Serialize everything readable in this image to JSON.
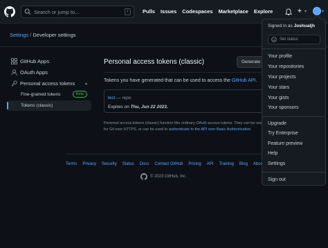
{
  "header": {
    "search_placeholder": "Search or jump to...",
    "search_shortcut": "/",
    "nav": [
      "Pulls",
      "Issues",
      "Codespaces",
      "Marketplace",
      "Explore"
    ],
    "plus_label": "+"
  },
  "breadcrumb": {
    "settings": "Settings",
    "separator": "/",
    "current": "Developer settings"
  },
  "sidebar": {
    "items": [
      {
        "label": "GitHub Apps",
        "icon": "apps-icon"
      },
      {
        "label": "OAuth Apps",
        "icon": "person-icon"
      },
      {
        "label": "Personal access tokens",
        "icon": "key-icon"
      }
    ],
    "sub_items": [
      {
        "label": "Fine-grained tokens",
        "badge": "Beta"
      },
      {
        "label": "Tokens (classic)"
      }
    ]
  },
  "main": {
    "title": "Personal access tokens (classic)",
    "generate_button": "Generate new token",
    "description_prefix": "Tokens you have generated that can be used to access the ",
    "description_link": "GitHub API",
    "description_suffix": ".",
    "token": {
      "name": "test",
      "scope": "— repo",
      "expires_label": "Expires on ",
      "expires_date": "Thu, Jun 22 2023."
    },
    "note_line1": "Personal access tokens (classic) function like ordinary OAuth access tokens. They can be used instead of a password",
    "note_line2_prefix": "for Git over HTTPS, or can be used to ",
    "note_line2_link": "authenticate to the API over Basic Authentication"
  },
  "footer": {
    "links": [
      "Terms",
      "Privacy",
      "Security",
      "Status",
      "Docs",
      "Contact GitHub",
      "Pricing",
      "API",
      "Training",
      "Blog",
      "About"
    ],
    "copyright": "© 2023 GitHub, Inc."
  },
  "dropdown": {
    "signed_in_prefix": "Signed in as ",
    "username": "Joshualjh",
    "status_placeholder": "Set status",
    "group1": [
      "Your profile",
      "Your repositories",
      "Your projects",
      "Your stars",
      "Your gists",
      "Your sponsors"
    ],
    "group2": [
      "Upgrade",
      "Try Enterprise",
      "Feature preview",
      "Help",
      "Settings"
    ],
    "sign_out": "Sign out"
  },
  "colors": {
    "background": "#0d1117",
    "header": "#161b22",
    "link": "#58a6ff",
    "beta_badge": "#3fb950"
  }
}
